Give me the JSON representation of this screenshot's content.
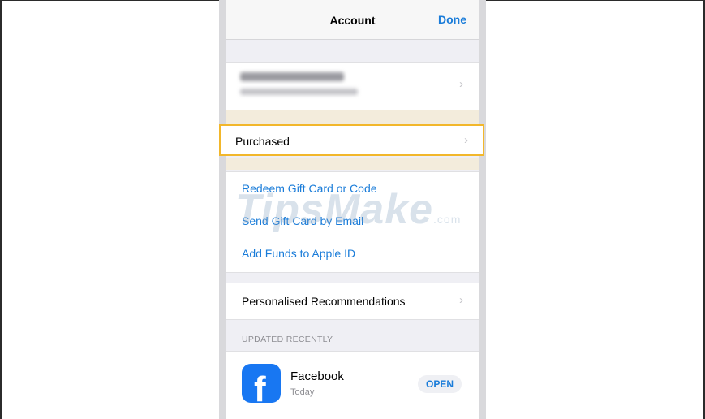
{
  "header": {
    "title": "Account",
    "done_label": "Done"
  },
  "account": {
    "chevron": "›"
  },
  "purchased": {
    "label": "Purchased",
    "chevron": "›"
  },
  "links": [
    {
      "label": "Redeem Gift Card or Code"
    },
    {
      "label": "Send Gift Card by Email"
    },
    {
      "label": "Add Funds to Apple ID"
    }
  ],
  "watermark": {
    "brand": "TipsMake",
    "suffix": ".com"
  },
  "recommendations": {
    "label": "Personalised Recommendations",
    "chevron": "›"
  },
  "updated": {
    "header": "UPDATED RECENTLY",
    "app": {
      "name": "Facebook",
      "date": "Today",
      "button": "OPEN",
      "icon_glyph": "f",
      "icon": "facebook-app-icon"
    }
  },
  "colors": {
    "accent": "#1a7cd9",
    "highlight_border": "#f2b72b",
    "facebook_blue": "#1877f2"
  }
}
